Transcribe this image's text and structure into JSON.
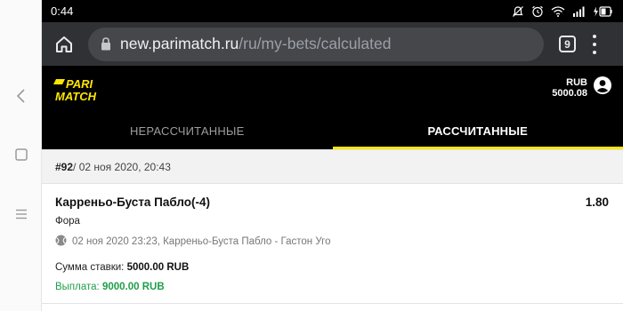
{
  "status_bar": {
    "time": "0:44"
  },
  "browser": {
    "url_host": "new.parimatch.ru",
    "url_path": "/ru/my-bets/calculated",
    "tab_count": "9"
  },
  "site": {
    "logo_line1": "PARI",
    "logo_line2": "MATCH",
    "currency": "RUB",
    "balance": "5000.08"
  },
  "tabs": [
    {
      "label": "НЕРАССЧИТАННЫЕ",
      "active": false
    },
    {
      "label": "РАССЧИТАННЫЕ",
      "active": true
    }
  ],
  "bet": {
    "number": "#92",
    "placed_at": " / 02 ноя 2020, 20:43",
    "selection": "Карреньо-Буста Пабло(-4)",
    "odds": "1.80",
    "market": "Фора",
    "event_info": "02 ноя 2020 23:23, Карреньо-Буста Пабло - Гастон Уго",
    "stake_label": "Сумма ставки: ",
    "stake_value": "5000.00 RUB",
    "payout_label": "Выплата: ",
    "payout_value": "9000.00 RUB"
  },
  "colors": {
    "brand_yellow": "#ffe600",
    "payout_green": "#1e9e4a"
  },
  "icons": [
    "back-icon",
    "square-icon",
    "menu-lines-icon",
    "home-icon",
    "lock-icon",
    "user-icon",
    "tennis-ball-icon"
  ]
}
